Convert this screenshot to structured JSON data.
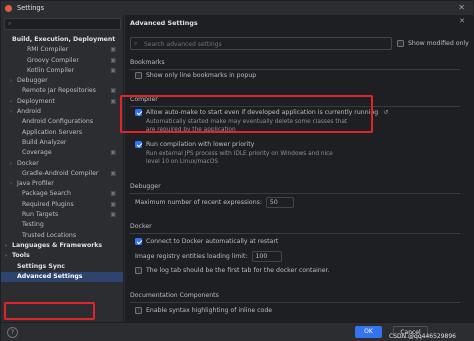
{
  "window": {
    "title": "Settings"
  },
  "sidebar": {
    "items": [
      {
        "label": "Build, Execution, Deployment",
        "bold": true,
        "arrow": "",
        "config": false
      },
      {
        "label": "RMI Compiler",
        "indent": 3,
        "config": true
      },
      {
        "label": "Groovy Compiler",
        "indent": 3,
        "config": true
      },
      {
        "label": "Kotlin Compiler",
        "indent": 3,
        "config": true
      },
      {
        "label": "Debugger",
        "indent": 1,
        "arrow": "›",
        "config": false
      },
      {
        "label": "Remote Jar Repositories",
        "indent": 2,
        "config": true
      },
      {
        "label": "Deployment",
        "indent": 1,
        "arrow": "›",
        "config": true
      },
      {
        "label": "Android",
        "indent": 1,
        "arrow": "›",
        "config": false
      },
      {
        "label": "Android Configurations",
        "indent": 2,
        "config": false
      },
      {
        "label": "Application Servers",
        "indent": 2,
        "config": false
      },
      {
        "label": "Build Analyzer",
        "indent": 2,
        "config": false
      },
      {
        "label": "Coverage",
        "indent": 2,
        "config": true
      },
      {
        "label": "Docker",
        "indent": 1,
        "arrow": "›",
        "config": false
      },
      {
        "label": "Gradle-Android Compiler",
        "indent": 2,
        "config": true
      },
      {
        "label": "Java Profiler",
        "indent": 1,
        "arrow": "›",
        "config": false
      },
      {
        "label": "Package Search",
        "indent": 2,
        "config": true
      },
      {
        "label": "Required Plugins",
        "indent": 2,
        "config": true
      },
      {
        "label": "Run Targets",
        "indent": 2,
        "config": true
      },
      {
        "label": "Testing",
        "indent": 2,
        "config": false
      },
      {
        "label": "Trusted Locations",
        "indent": 2,
        "config": false
      },
      {
        "label": "Languages & Frameworks",
        "bold": true,
        "indent": 0,
        "arrow": "›",
        "config": false
      },
      {
        "label": "Tools",
        "bold": true,
        "indent": 0,
        "arrow": "›",
        "config": false
      },
      {
        "label": "Settings Sync",
        "bold": true,
        "indent": 1,
        "config": false
      },
      {
        "label": "Advanced Settings",
        "bold": true,
        "indent": 1,
        "config": false,
        "selected": true
      }
    ]
  },
  "panel": {
    "title": "Advanced Settings",
    "search_placeholder": "Search advanced settings",
    "show_modified_label": "Show modified only",
    "sections": {
      "bookmarks": {
        "title": "Bookmarks",
        "opt1": "Show only line bookmarks in popup"
      },
      "compiler": {
        "title": "Compiler",
        "opt1": "Allow auto-make to start even if developed application is currently running",
        "opt1_desc1": "Automatically started make may eventually delete some classes that",
        "opt1_desc2": "are required by the application",
        "opt2": "Run compilation with lower priority",
        "opt2_desc1": "Run external JPS process with IDLE priority on Windows and nice",
        "opt2_desc2": "level 10 on Linux/macOS"
      },
      "debugger": {
        "title": "Debugger",
        "opt1": "Maximum number of recent expressions:",
        "opt1_value": "50"
      },
      "docker": {
        "title": "Docker",
        "opt1": "Connect to Docker automatically at restart",
        "opt2": "Image registry entities loading limit:",
        "opt2_value": "100",
        "opt3": "The log tab should be the first tab for the docker container."
      },
      "docs": {
        "title": "Documentation Components",
        "opt1": "Enable syntax highlighting of inline code"
      }
    }
  },
  "footer": {
    "help": "?",
    "ok": "OK",
    "cancel": "Cancel",
    "watermark": "CSDN @qq446529896"
  },
  "colors": {
    "accent": "#3574f0",
    "highlight": "#e0242b",
    "selected": "#2e436e"
  }
}
